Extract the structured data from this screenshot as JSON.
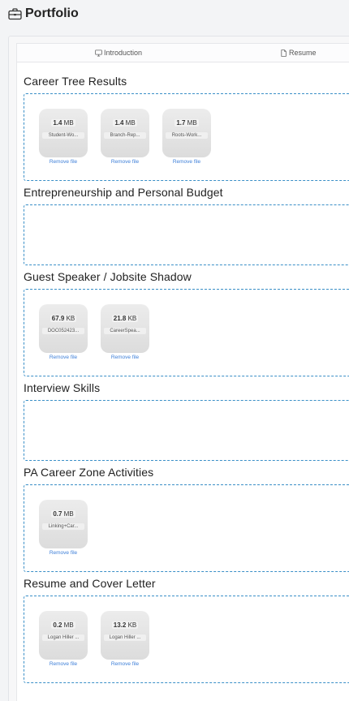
{
  "header": {
    "title": "Portfolio",
    "icon": "briefcase-icon"
  },
  "tabs": [
    {
      "label": "Introduction",
      "icon": "monitor-icon"
    },
    {
      "label": "Resume",
      "icon": "document-icon"
    }
  ],
  "sections": [
    {
      "title": "Career Tree Results",
      "files": [
        {
          "size_num": "1.4",
          "size_unit": "MB",
          "name": "Student-Wo...",
          "remove": "Remove file"
        },
        {
          "size_num": "1.4",
          "size_unit": "MB",
          "name": "Branch-Rep...",
          "remove": "Remove file"
        },
        {
          "size_num": "1.7",
          "size_unit": "MB",
          "name": "Roots-Work...",
          "remove": "Remove file"
        }
      ]
    },
    {
      "title": "Entrepreneurship and Personal Budget",
      "files": []
    },
    {
      "title": "Guest Speaker / Jobsite Shadow",
      "files": [
        {
          "size_num": "67.9",
          "size_unit": "KB",
          "name": "DOC052423...",
          "remove": "Remove file"
        },
        {
          "size_num": "21.8",
          "size_unit": "KB",
          "name": "CareerSpea...",
          "remove": "Remove file"
        }
      ]
    },
    {
      "title": "Interview Skills",
      "files": []
    },
    {
      "title": "PA Career Zone Activities",
      "files": [
        {
          "size_num": "0.7",
          "size_unit": "MB",
          "name": "Linking+Car...",
          "remove": "Remove file"
        }
      ]
    },
    {
      "title": "Resume and Cover Letter",
      "files": [
        {
          "size_num": "0.2",
          "size_unit": "MB",
          "name": "Logan Hiller ...",
          "remove": "Remove file"
        },
        {
          "size_num": "13.2",
          "size_unit": "KB",
          "name": "Logan Hiller ...",
          "remove": "Remove file"
        }
      ]
    }
  ]
}
